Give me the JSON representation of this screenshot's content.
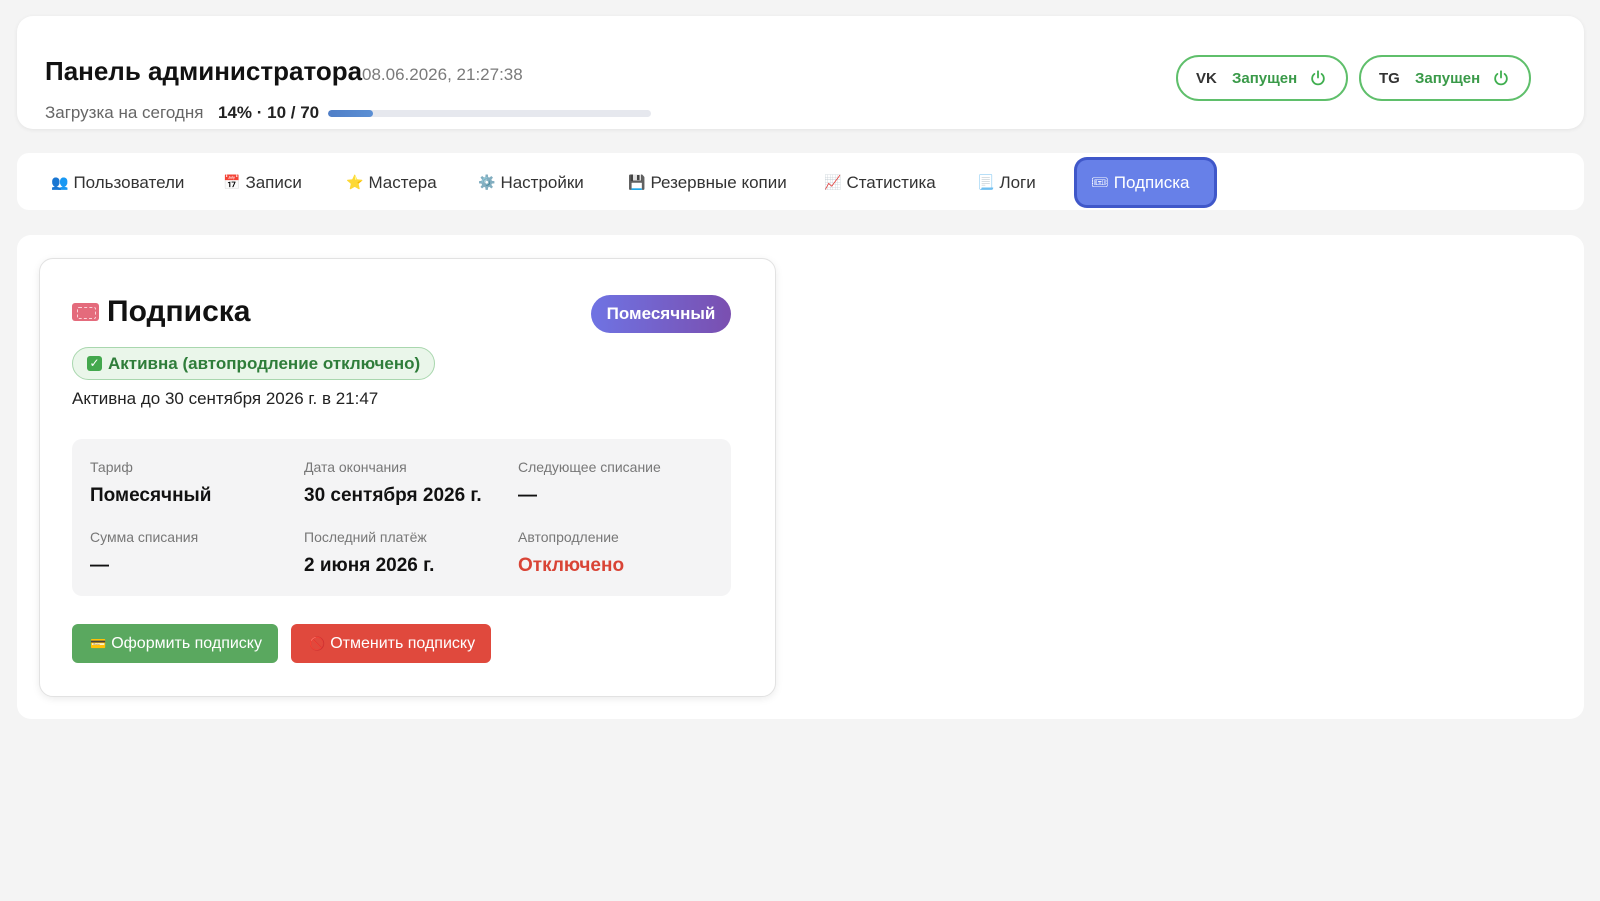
{
  "header": {
    "title": "Панель администратора",
    "datetime": "08.06.2026, 21:27:38",
    "load_label": "Загрузка на сегодня",
    "load_value": "14% · 10 / 70",
    "load_percent": 14,
    "services": [
      {
        "name": "VK",
        "status": "Запущен",
        "icon": "power-icon"
      },
      {
        "name": "TG",
        "status": "Запущен",
        "icon": "power-icon"
      }
    ]
  },
  "tabs": [
    {
      "icon": "👥",
      "label": "Пользователи"
    },
    {
      "icon": "📅",
      "label": "Записи"
    },
    {
      "icon": "⭐",
      "label": "Мастера"
    },
    {
      "icon": "⚙️",
      "label": "Настройки"
    },
    {
      "icon": "💾",
      "label": "Резервные копии"
    },
    {
      "icon": "📈",
      "label": "Статистика"
    },
    {
      "icon": "📃",
      "label": "Логи"
    },
    {
      "icon": "🎟",
      "label": "Подписка",
      "active": true
    }
  ],
  "subscription": {
    "title": "Подписка",
    "plan_badge": "Помесячный",
    "status_badge": "Активна (автопродление отключено)",
    "active_until": "Активна до 30 сентября 2026 г. в 21:47",
    "details": [
      {
        "label": "Тариф",
        "value": "Помесячный"
      },
      {
        "label": "Дата окончания",
        "value": "30 сентября 2026 г."
      },
      {
        "label": "Следующее списание",
        "value": "—"
      },
      {
        "label": "Сумма списания",
        "value": "—"
      },
      {
        "label": "Последний платёж",
        "value": "2 июня 2026 г."
      },
      {
        "label": "Автопродление",
        "value": "Отключено"
      }
    ],
    "subscribe_button": "Оформить подписку",
    "subscribe_icon": "💳",
    "cancel_button": "Отменить подписку",
    "cancel_icon": "🚫"
  },
  "colors": {
    "accent": "#6780e8",
    "success": "#3a9a49",
    "danger": "#d94436"
  }
}
